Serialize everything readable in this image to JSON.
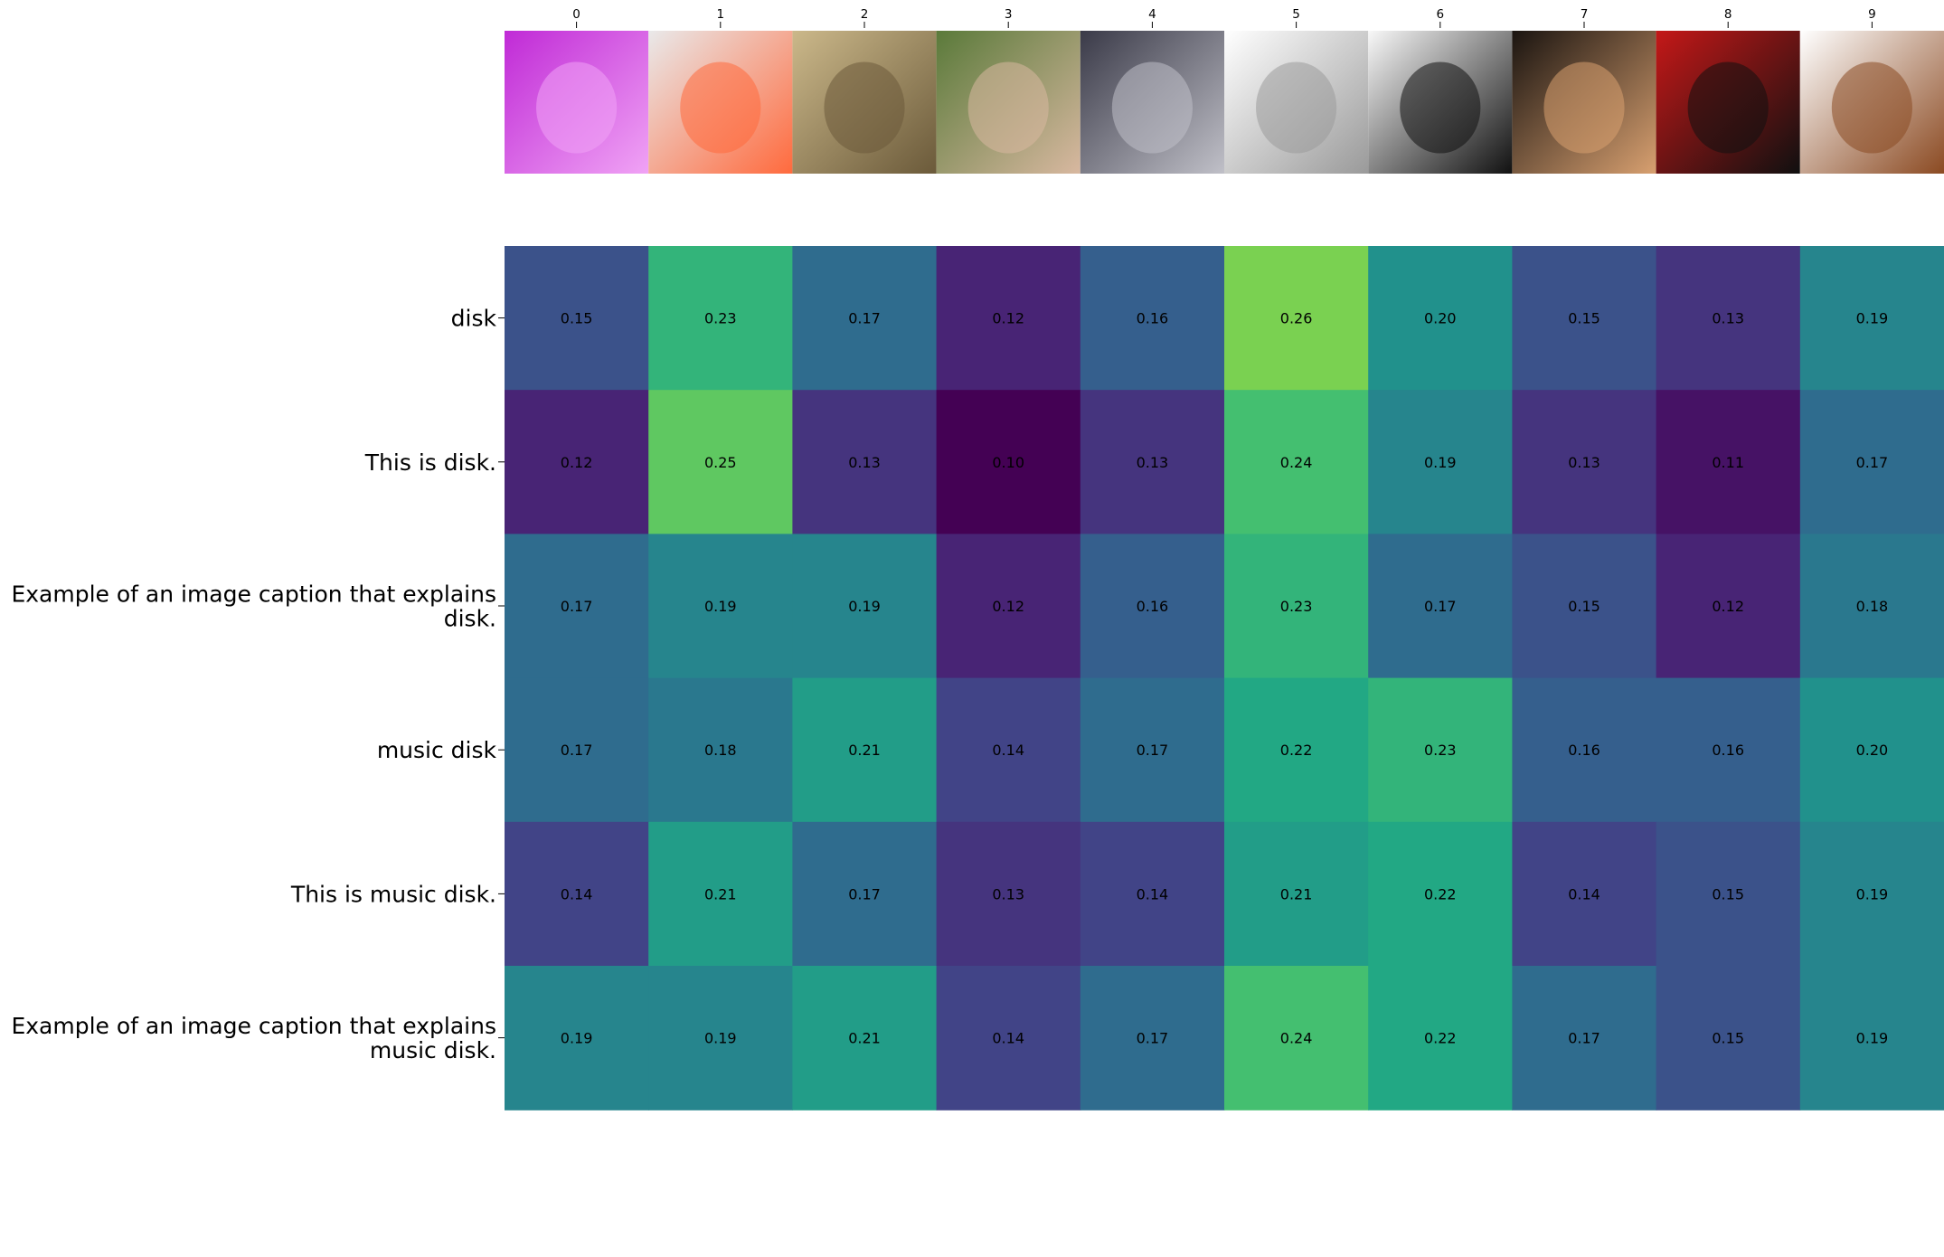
{
  "chart_data": {
    "type": "heatmap",
    "title": "",
    "xlabel": "",
    "ylabel": "",
    "columns": [
      "0",
      "1",
      "2",
      "3",
      "4",
      "5",
      "6",
      "7",
      "8",
      "9"
    ],
    "rows": [
      [
        "disk"
      ],
      [
        "This is disk."
      ],
      [
        "Example of an image caption that explains",
        "disk."
      ],
      [
        "music disk"
      ],
      [
        "This is music disk."
      ],
      [
        "Example of an image caption that explains",
        "music disk."
      ]
    ],
    "values": [
      [
        0.15,
        0.23,
        0.17,
        0.12,
        0.16,
        0.26,
        0.2,
        0.15,
        0.13,
        0.19
      ],
      [
        0.12,
        0.25,
        0.13,
        0.1,
        0.13,
        0.24,
        0.19,
        0.13,
        0.11,
        0.17
      ],
      [
        0.17,
        0.19,
        0.19,
        0.12,
        0.16,
        0.23,
        0.17,
        0.15,
        0.12,
        0.18
      ],
      [
        0.17,
        0.18,
        0.21,
        0.14,
        0.17,
        0.22,
        0.23,
        0.16,
        0.16,
        0.2
      ],
      [
        0.14,
        0.21,
        0.17,
        0.13,
        0.14,
        0.21,
        0.22,
        0.14,
        0.15,
        0.19
      ],
      [
        0.19,
        0.19,
        0.21,
        0.14,
        0.17,
        0.24,
        0.22,
        0.17,
        0.15,
        0.19
      ]
    ],
    "value_format": "2-decimal",
    "colormap": "viridis",
    "color_range": [
      0.1,
      0.3
    ],
    "grid": false,
    "column_images": [
      "performer-pink-stage-photo",
      "floppy-disks-photo",
      "vintage-jazz-band-photo",
      "man-with-hat-photo",
      "outdoor-concert-stage-photo",
      "hard-disk-drive-photo",
      "vinyl-record-photo",
      "female-singer-photo",
      "guitarist-red-backdrop-photo",
      "pan-flute-photo"
    ],
    "image_palette": [
      [
        "#c02ad6",
        "#f0a3f5"
      ],
      [
        "#e9e9ea",
        "#ff6a3d"
      ],
      [
        "#cbb88a",
        "#6b5a3a"
      ],
      [
        "#5a7a3a",
        "#d8b8a0"
      ],
      [
        "#3a3a48",
        "#c0c0c8"
      ],
      [
        "#ffffff",
        "#9a9a9a"
      ],
      [
        "#f8f8f8",
        "#111111"
      ],
      [
        "#1a1410",
        "#d8a070"
      ],
      [
        "#c41818",
        "#101010"
      ],
      [
        "#ffffff",
        "#8b4a22"
      ]
    ]
  }
}
